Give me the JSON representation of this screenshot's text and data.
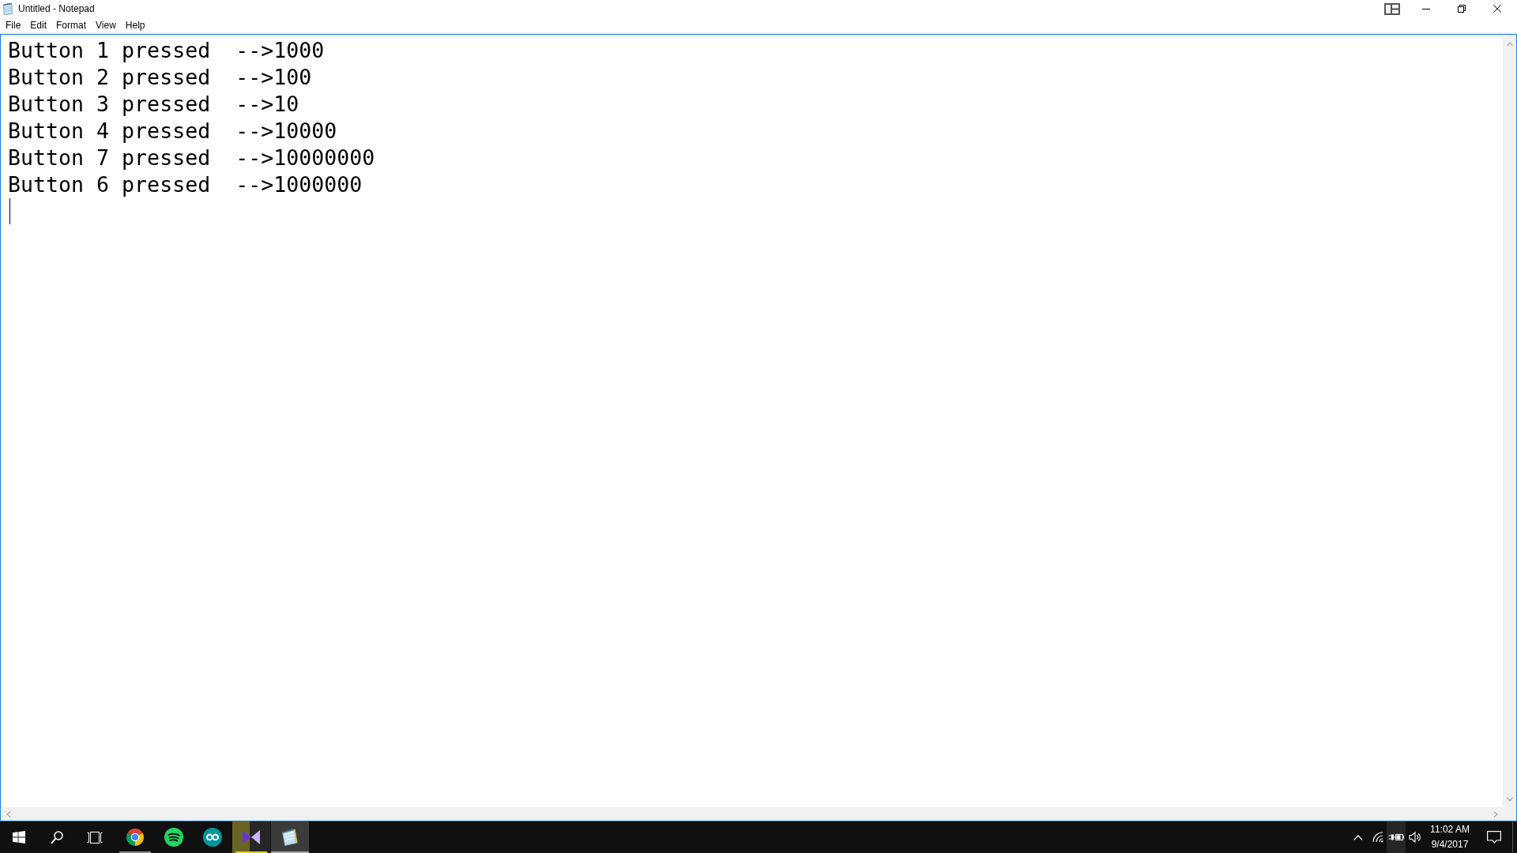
{
  "window": {
    "title": "Untitled - Notepad"
  },
  "menu": [
    "File",
    "Edit",
    "Format",
    "View",
    "Help"
  ],
  "editor": {
    "lines": [
      "Button 1 pressed  -->1000",
      "Button 2 pressed  -->100",
      "Button 3 pressed  -->10",
      "Button 4 pressed  -->10000",
      "Button 7 pressed  -->10000000",
      "Button 6 pressed  -->1000000"
    ]
  },
  "taskbar": {
    "apps": [
      {
        "kind": "chrome",
        "running": true,
        "selected": false
      },
      {
        "kind": "spotify",
        "running": false,
        "selected": false
      },
      {
        "kind": "arduino",
        "running": false,
        "selected": false
      },
      {
        "kind": "visual-studio",
        "running": true,
        "selected": false,
        "progress": {
          "level": 0.45,
          "paused": true
        }
      },
      {
        "kind": "notepad",
        "running": true,
        "selected": true
      }
    ],
    "tray": [
      {
        "kind": "chevron",
        "hovered": false
      },
      {
        "kind": "wifi",
        "hovered": false
      },
      {
        "kind": "battery",
        "hovered": true
      },
      {
        "kind": "volume",
        "hovered": false
      }
    ],
    "clock": {
      "time": "11:02 AM",
      "date": "9/4/2017"
    }
  }
}
